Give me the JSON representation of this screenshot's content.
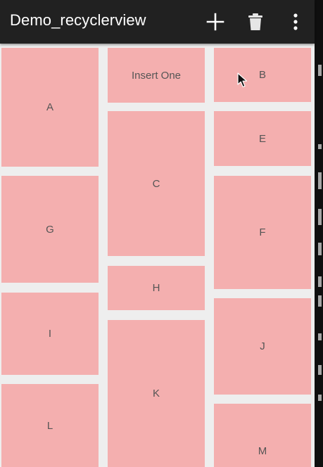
{
  "app_bar": {
    "title": "Demo_recyclerview",
    "actions": [
      {
        "name": "add-icon",
        "label": "+"
      },
      {
        "name": "trash-icon",
        "label": "delete"
      },
      {
        "name": "overflow-menu-icon",
        "label": "more options"
      }
    ]
  },
  "grid": {
    "items": {
      "a": "A",
      "insert_one": "Insert One",
      "b": "B",
      "c": "C",
      "e": "E",
      "g": "G",
      "f": "F",
      "h": "H",
      "i": "I",
      "k": "K",
      "j": "J",
      "l": "L",
      "m": "M"
    }
  },
  "colors": {
    "app_bar": "#212121",
    "card": "#f4afaf",
    "background": "#eeeeee",
    "text": "#555555"
  }
}
